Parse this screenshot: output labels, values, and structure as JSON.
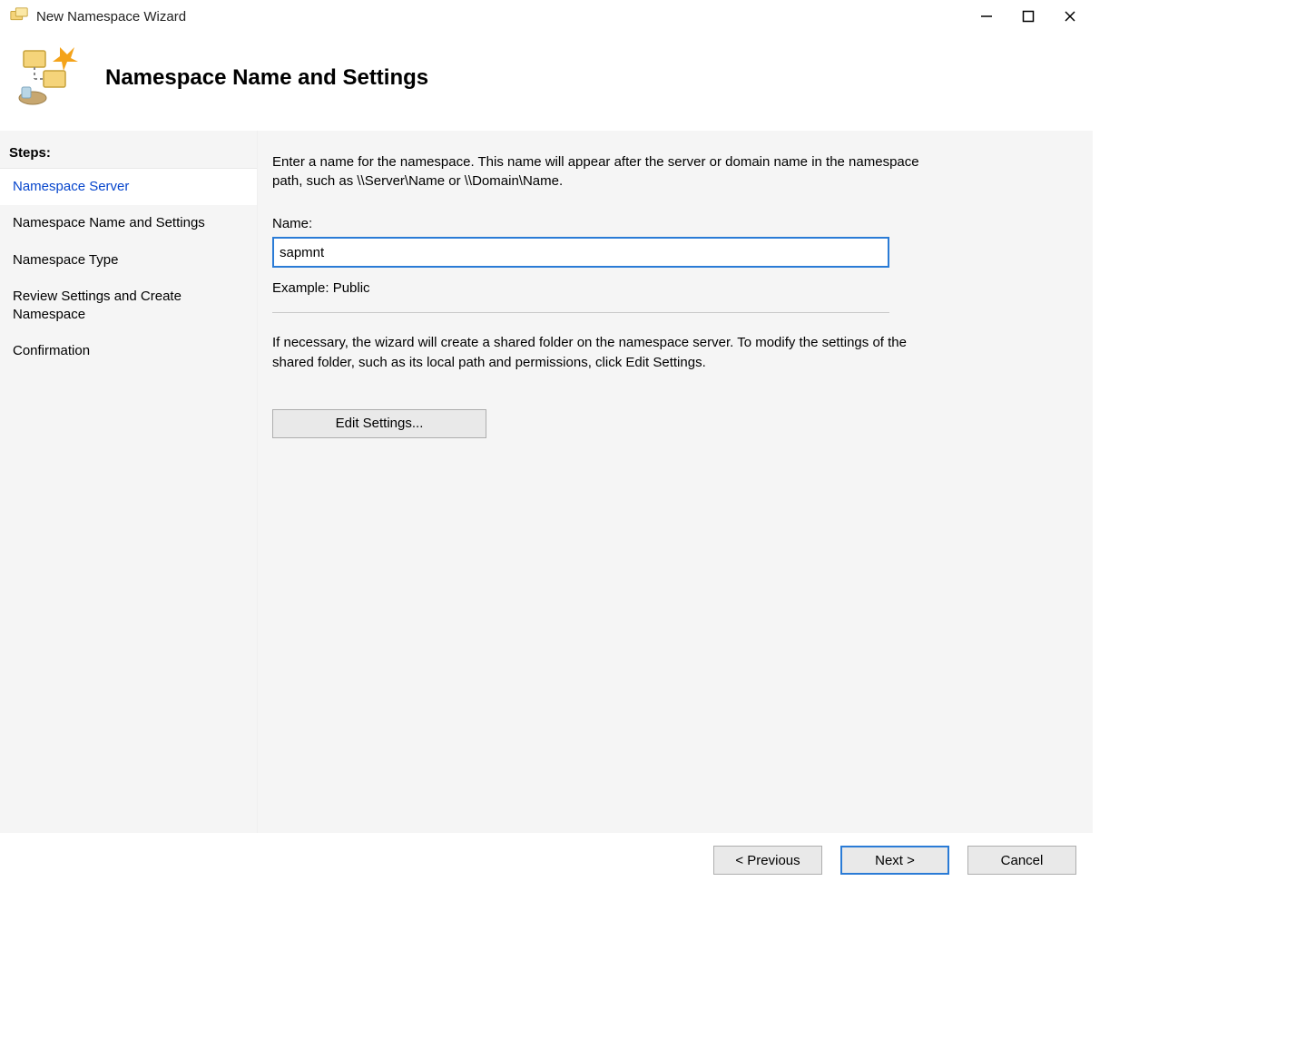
{
  "window": {
    "title": "New Namespace Wizard"
  },
  "header": {
    "title": "Namespace Name and Settings"
  },
  "sidebar": {
    "steps_label": "Steps:",
    "items": [
      {
        "label": "Namespace Server"
      },
      {
        "label": "Namespace Name and Settings"
      },
      {
        "label": "Namespace Type"
      },
      {
        "label": "Review Settings and Create Namespace"
      },
      {
        "label": "Confirmation"
      }
    ]
  },
  "content": {
    "description": "Enter a name for the namespace. This name will appear after the server or domain name in the namespace path, such as \\\\Server\\Name or \\\\Domain\\Name.",
    "name_label": "Name:",
    "name_value": "sapmnt",
    "example_label": "Example: Public",
    "note": "If necessary, the wizard will create a shared folder on the namespace server. To modify the settings of the shared folder, such as its local path and permissions, click Edit Settings.",
    "edit_button_label": "Edit Settings..."
  },
  "footer": {
    "previous": "< Previous",
    "next": "Next >",
    "cancel": "Cancel"
  }
}
